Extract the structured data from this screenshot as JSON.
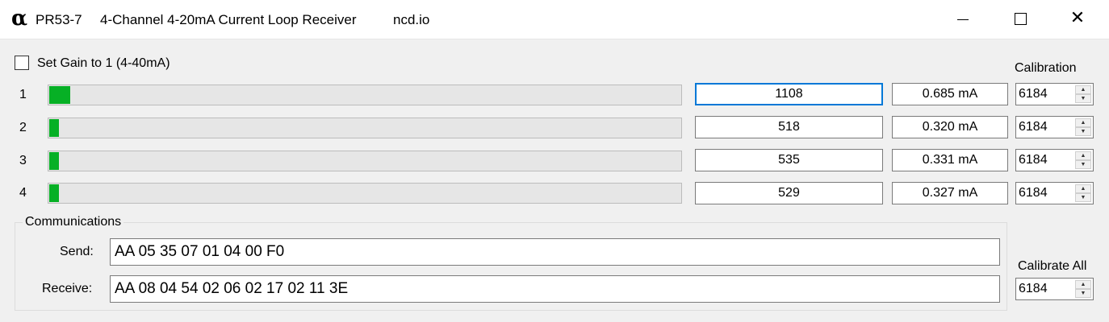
{
  "window": {
    "icon": "alpha-icon",
    "icon_glyph": "α",
    "title_model": "PR53-7",
    "title_description": "4-Channel 4-20mA Current Loop Receiver",
    "title_site": "ncd.io",
    "controls": {
      "minimize": "minimize-icon",
      "maximize": "maximize-icon",
      "close_glyph": "✕"
    }
  },
  "gain": {
    "label": "Set Gain to 1 (4-40mA)",
    "checked": false
  },
  "calibration_header": "Calibration",
  "channels": [
    {
      "number": "1",
      "level": 0.033,
      "raw": "1108",
      "current": "0.685 mA",
      "calibration": "6184"
    },
    {
      "number": "2",
      "level": 0.015,
      "raw": "518",
      "current": "0.320 mA",
      "calibration": "6184"
    },
    {
      "number": "3",
      "level": 0.015,
      "raw": "535",
      "current": "0.331 mA",
      "calibration": "6184"
    },
    {
      "number": "4",
      "level": 0.015,
      "raw": "529",
      "current": "0.327 mA",
      "calibration": "6184"
    }
  ],
  "communications": {
    "title": "Communications",
    "send_label": "Send:",
    "send_value": "AA 05 35 07 01 04 00 F0",
    "receive_label": "Receive:",
    "receive_value": "AA 08 04 54 02 06 02 17 02 11 3E"
  },
  "calibrate_all": {
    "label": "Calibrate All",
    "value": "6184"
  },
  "colors": {
    "progress_fill": "#06b025",
    "focus_border": "#0078d7"
  }
}
